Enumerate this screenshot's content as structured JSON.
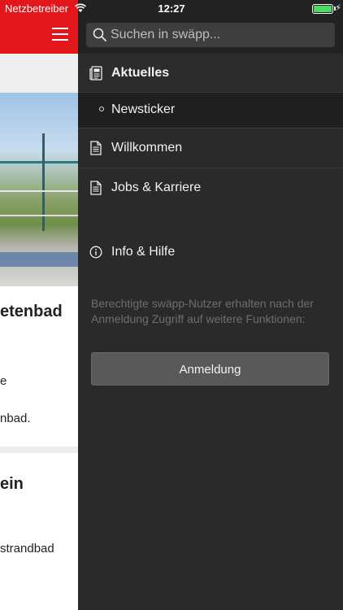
{
  "status_bar": {
    "carrier": "Netzbetreiber",
    "time": "12:27",
    "battery_level": 1.0,
    "battery_color": "#4cd964",
    "charging_icon": "bolt-icon",
    "wifi_icon": "wifi-icon"
  },
  "colors": {
    "header_red": "#e3161b",
    "drawer_bg": "#2a2a2a",
    "button_bg": "#595959"
  },
  "background_page": {
    "menu_icon": "hamburger-icon",
    "article1_title_fragment": "etenbad",
    "article1_line1_fragment": "e",
    "article1_line2_fragment": "nbad.",
    "article2_title_fragment": "ein",
    "article2_line1_fragment": "strandbad"
  },
  "drawer": {
    "search": {
      "placeholder": "Suchen in swäpp...",
      "icon": "search-icon"
    },
    "items": [
      {
        "label": "Aktuelles",
        "icon": "newspaper-icon",
        "active": true
      },
      {
        "label": "Newsticker",
        "icon": "bullet-icon",
        "sub": true
      },
      {
        "label": "Willkommen",
        "icon": "document-icon"
      },
      {
        "label": "Jobs & Karriere",
        "icon": "document-icon"
      },
      {
        "label": "Info & Hilfe",
        "icon": "info-icon"
      }
    ],
    "login_hint": "Berechtigte swäpp-Nutzer erhalten nach der Anmeldung Zugriff auf weitere Funktionen:",
    "login_button": "Anmeldung"
  }
}
